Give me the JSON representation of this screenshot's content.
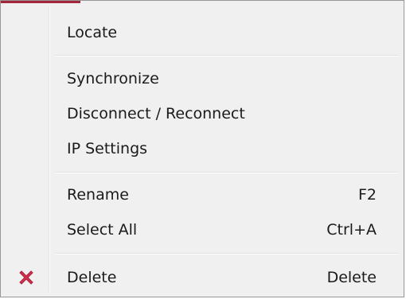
{
  "menu": {
    "items": [
      {
        "label": "Locate",
        "shortcut": ""
      },
      {
        "label": "Synchronize",
        "shortcut": ""
      },
      {
        "label": "Disconnect / Reconnect",
        "shortcut": ""
      },
      {
        "label": "IP Settings",
        "shortcut": ""
      },
      {
        "label": "Rename",
        "shortcut": "F2"
      },
      {
        "label": "Select All",
        "shortcut": "Ctrl+A"
      },
      {
        "label": "Delete",
        "shortcut": "Delete",
        "icon": "red-x-icon"
      }
    ]
  },
  "colors": {
    "accent": "#a3263a",
    "delete_icon": "#d9304a",
    "menu_background": "#f0f0f0"
  }
}
